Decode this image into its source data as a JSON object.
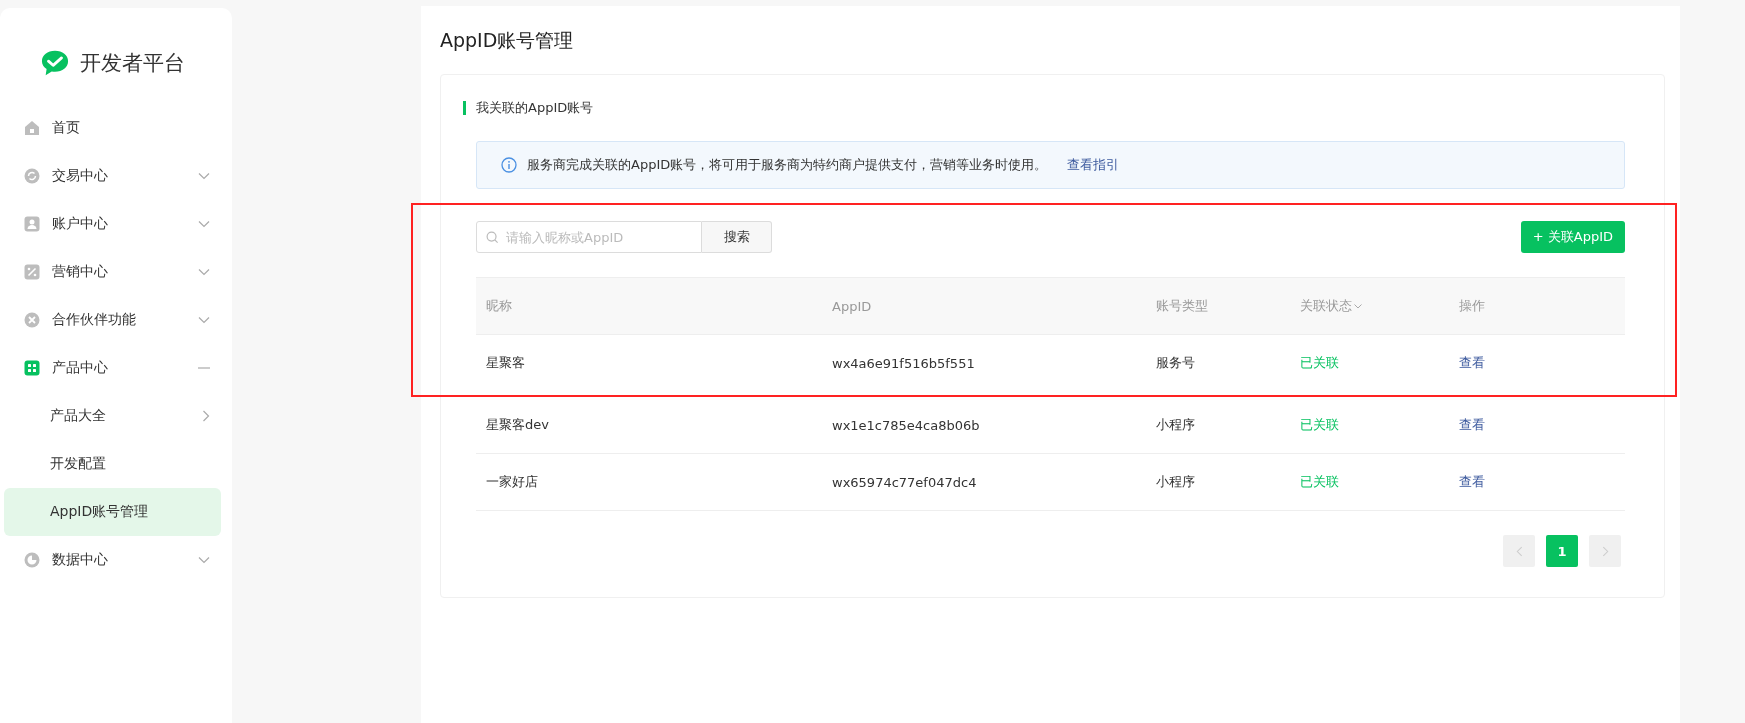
{
  "sidebar": {
    "logo_text": "开发者平台",
    "items": [
      {
        "label": "首页",
        "kind": "link",
        "selected": false
      },
      {
        "label": "交易中心",
        "kind": "group",
        "expanded": false,
        "selected": false
      },
      {
        "label": "账户中心",
        "kind": "group",
        "expanded": false,
        "selected": false
      },
      {
        "label": "营销中心",
        "kind": "group",
        "expanded": false,
        "selected": false
      },
      {
        "label": "合作伙伴功能",
        "kind": "group",
        "expanded": false,
        "selected": false
      },
      {
        "label": "产品中心",
        "kind": "group",
        "expanded": true,
        "selected": true,
        "children": [
          {
            "label": "产品大全",
            "kind": "group",
            "expanded": false,
            "selected": false
          },
          {
            "label": "开发配置",
            "kind": "link",
            "selected": false
          },
          {
            "label": "AppID账号管理",
            "kind": "link",
            "selected": true
          }
        ]
      },
      {
        "label": "数据中心",
        "kind": "group",
        "expanded": false,
        "selected": false
      }
    ]
  },
  "page": {
    "title": "AppID账号管理",
    "section_title": "我关联的AppID账号",
    "notice": {
      "text": "服务商完成关联的AppID账号，将可用于服务商为特约商户提供支付，营销等业务时使用。",
      "link": "查看指引"
    },
    "search": {
      "placeholder": "请输入昵称或AppID",
      "button": "搜索"
    },
    "add_button": "+ 关联AppID",
    "table": {
      "columns": [
        {
          "label": "昵称",
          "sortable": false
        },
        {
          "label": "AppID",
          "sortable": false
        },
        {
          "label": "账号类型",
          "sortable": false
        },
        {
          "label": "关联状态",
          "sortable": true
        },
        {
          "label": "操作",
          "sortable": false
        }
      ],
      "rows": [
        {
          "nickname": "星聚客",
          "appid": "wx4a6e91f516b5f551",
          "type": "服务号",
          "status": "已关联",
          "action": "查看",
          "highlighted": true
        },
        {
          "nickname": "星聚客dev",
          "appid": "wx1e1c785e4ca8b06b",
          "type": "小程序",
          "status": "已关联",
          "action": "查看",
          "highlighted": false
        },
        {
          "nickname": "一家好店",
          "appid": "wx65974c77ef047dc4",
          "type": "小程序",
          "status": "已关联",
          "action": "查看",
          "highlighted": false
        }
      ]
    },
    "pagination": {
      "prev_disabled": true,
      "next_disabled": true,
      "pages": [
        {
          "label": "1",
          "selected": true
        }
      ]
    }
  }
}
